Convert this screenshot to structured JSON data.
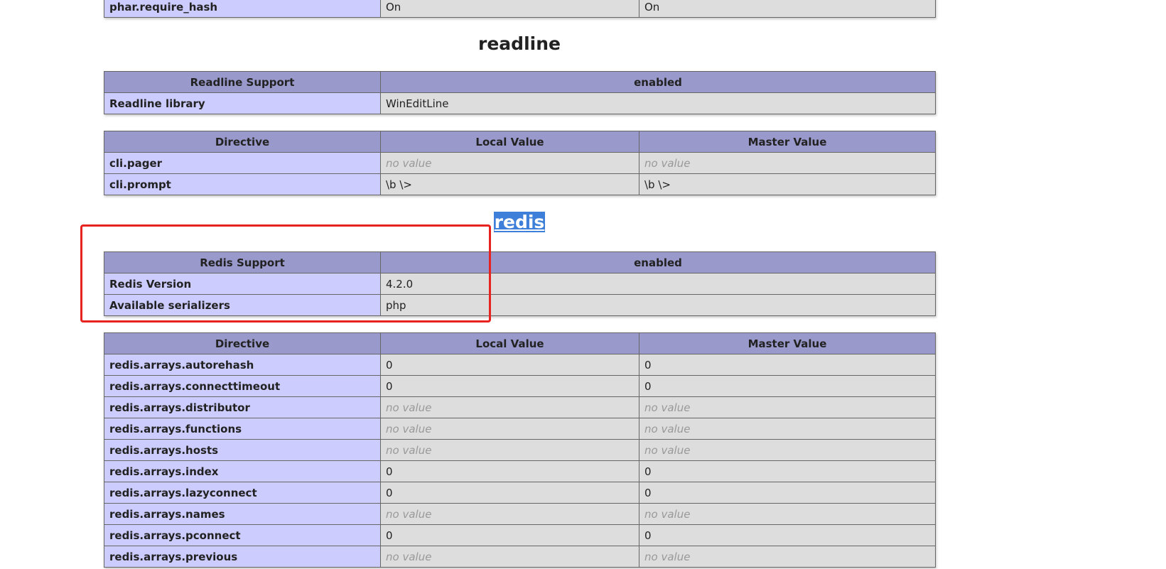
{
  "phar_row": {
    "directive": "phar.require_hash",
    "local": "On",
    "master": "On"
  },
  "readline": {
    "title": "readline",
    "support": {
      "label": "Readline Support",
      "value": "enabled"
    },
    "library": {
      "label": "Readline library",
      "value": "WinEditLine"
    },
    "directives_header": {
      "directive": "Directive",
      "local": "Local Value",
      "master": "Master Value"
    },
    "directives": [
      {
        "name": "cli.pager",
        "local": "no value",
        "master": "no value"
      },
      {
        "name": "cli.prompt",
        "local": "\\b \\>",
        "master": "\\b \\>"
      }
    ]
  },
  "redis": {
    "title": "redis",
    "support": {
      "label": "Redis Support",
      "value": "enabled"
    },
    "version": {
      "label": "Redis Version",
      "value": "4.2.0"
    },
    "serializers": {
      "label": "Available serializers",
      "value": "php"
    },
    "directives_header": {
      "directive": "Directive",
      "local": "Local Value",
      "master": "Master Value"
    },
    "directives": [
      {
        "name": "redis.arrays.autorehash",
        "local": "0",
        "master": "0"
      },
      {
        "name": "redis.arrays.connecttimeout",
        "local": "0",
        "master": "0"
      },
      {
        "name": "redis.arrays.distributor",
        "local": "no value",
        "master": "no value"
      },
      {
        "name": "redis.arrays.functions",
        "local": "no value",
        "master": "no value"
      },
      {
        "name": "redis.arrays.hosts",
        "local": "no value",
        "master": "no value"
      },
      {
        "name": "redis.arrays.index",
        "local": "0",
        "master": "0"
      },
      {
        "name": "redis.arrays.lazyconnect",
        "local": "0",
        "master": "0"
      },
      {
        "name": "redis.arrays.names",
        "local": "no value",
        "master": "no value"
      },
      {
        "name": "redis.arrays.pconnect",
        "local": "0",
        "master": "0"
      },
      {
        "name": "redis.arrays.previous",
        "local": "no value",
        "master": "no value"
      }
    ]
  },
  "colors": {
    "header_bg": "#9999cc",
    "label_bg": "#ccccff",
    "value_bg": "#dddddd",
    "annotation_red": "#e8221e",
    "selection_blue": "#3d7fd9"
  }
}
